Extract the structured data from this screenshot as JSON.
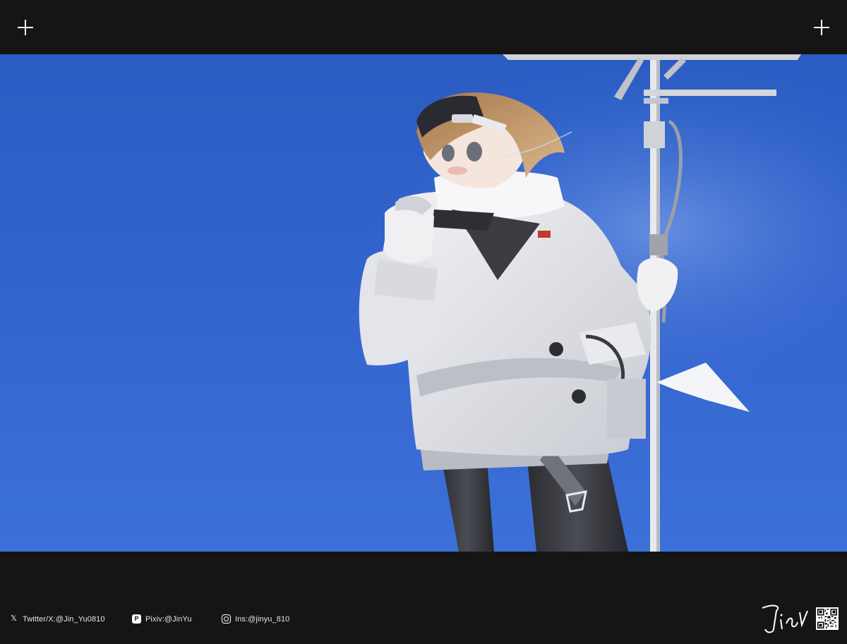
{
  "frame": {
    "top_left_icon": "plus-icon",
    "top_right_icon": "plus-icon"
  },
  "artwork": {
    "description_icon": "illustration",
    "sky_color": "#3567d0"
  },
  "footer": {
    "twitter": {
      "icon": "x-logo-icon",
      "label": "Twitter/X:@Jin_Yu0810"
    },
    "pixiv": {
      "icon": "pixiv-icon",
      "label": "Pixiv:@JinYu"
    },
    "instagram": {
      "icon": "instagram-icon",
      "label": "Ins:@jinyu_810"
    },
    "signature_icon": "artist-signature",
    "qr_icon": "qr-code-icon"
  }
}
